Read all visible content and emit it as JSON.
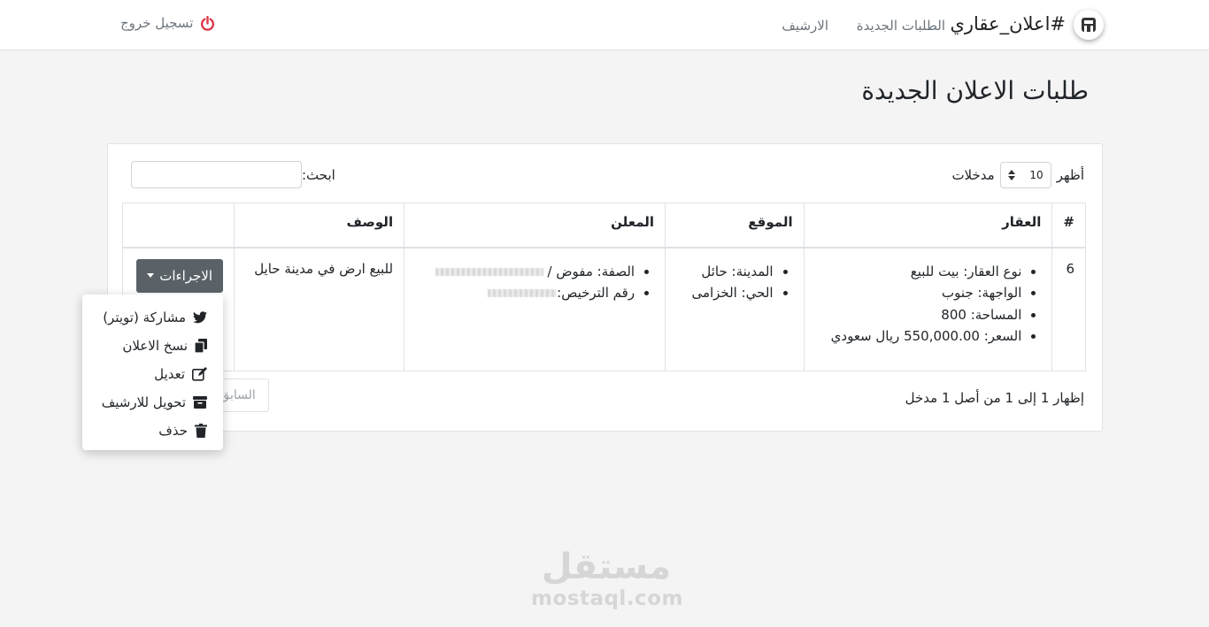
{
  "navbar": {
    "brand": "#اعلان_عقاري",
    "links": [
      "الطلبات الجديدة",
      "الارشيف"
    ],
    "logout": "تسجيل خروج"
  },
  "page": {
    "title": "طلبات الاعلان الجديدة"
  },
  "table_controls": {
    "show_label": "أظهر",
    "entries_value": "10",
    "entries_label": "مدخلات",
    "search_label": "ابحث:",
    "search_value": ""
  },
  "table": {
    "headers": [
      "#",
      "العقار",
      "الموقع",
      "المعلن",
      "الوصف",
      ""
    ],
    "rows": [
      {
        "id": "6",
        "property": [
          "نوع العقار: بيت للبيع",
          "الواجهة: جنوب",
          "المساحة: 800",
          "السعر: 550,000.00 ريال سعودي"
        ],
        "location": [
          "المدينة: حائل",
          "الحي: الخزامى"
        ],
        "advertiser": [
          "الصفة: مفوض /",
          "رقم الترخيص:"
        ],
        "description": "للبيع ارض في مدينة حايل",
        "actions_label": "الاجراءات"
      }
    ]
  },
  "dropdown": {
    "items": [
      "مشاركة (تويتر)",
      "نسخ الاعلان",
      "تعديل",
      "تحويل للارشيف",
      "حذف"
    ]
  },
  "footer": {
    "info": "إظهار 1 إلى 1 من أصل 1 مدخل",
    "prev": "السابق"
  },
  "watermark": {
    "arabic": "مستقل",
    "latin": "mostaql.com"
  },
  "colors": {
    "logout_icon": "#dc3545",
    "actions_button": "#5a6268",
    "background": "#f4f4f5"
  }
}
